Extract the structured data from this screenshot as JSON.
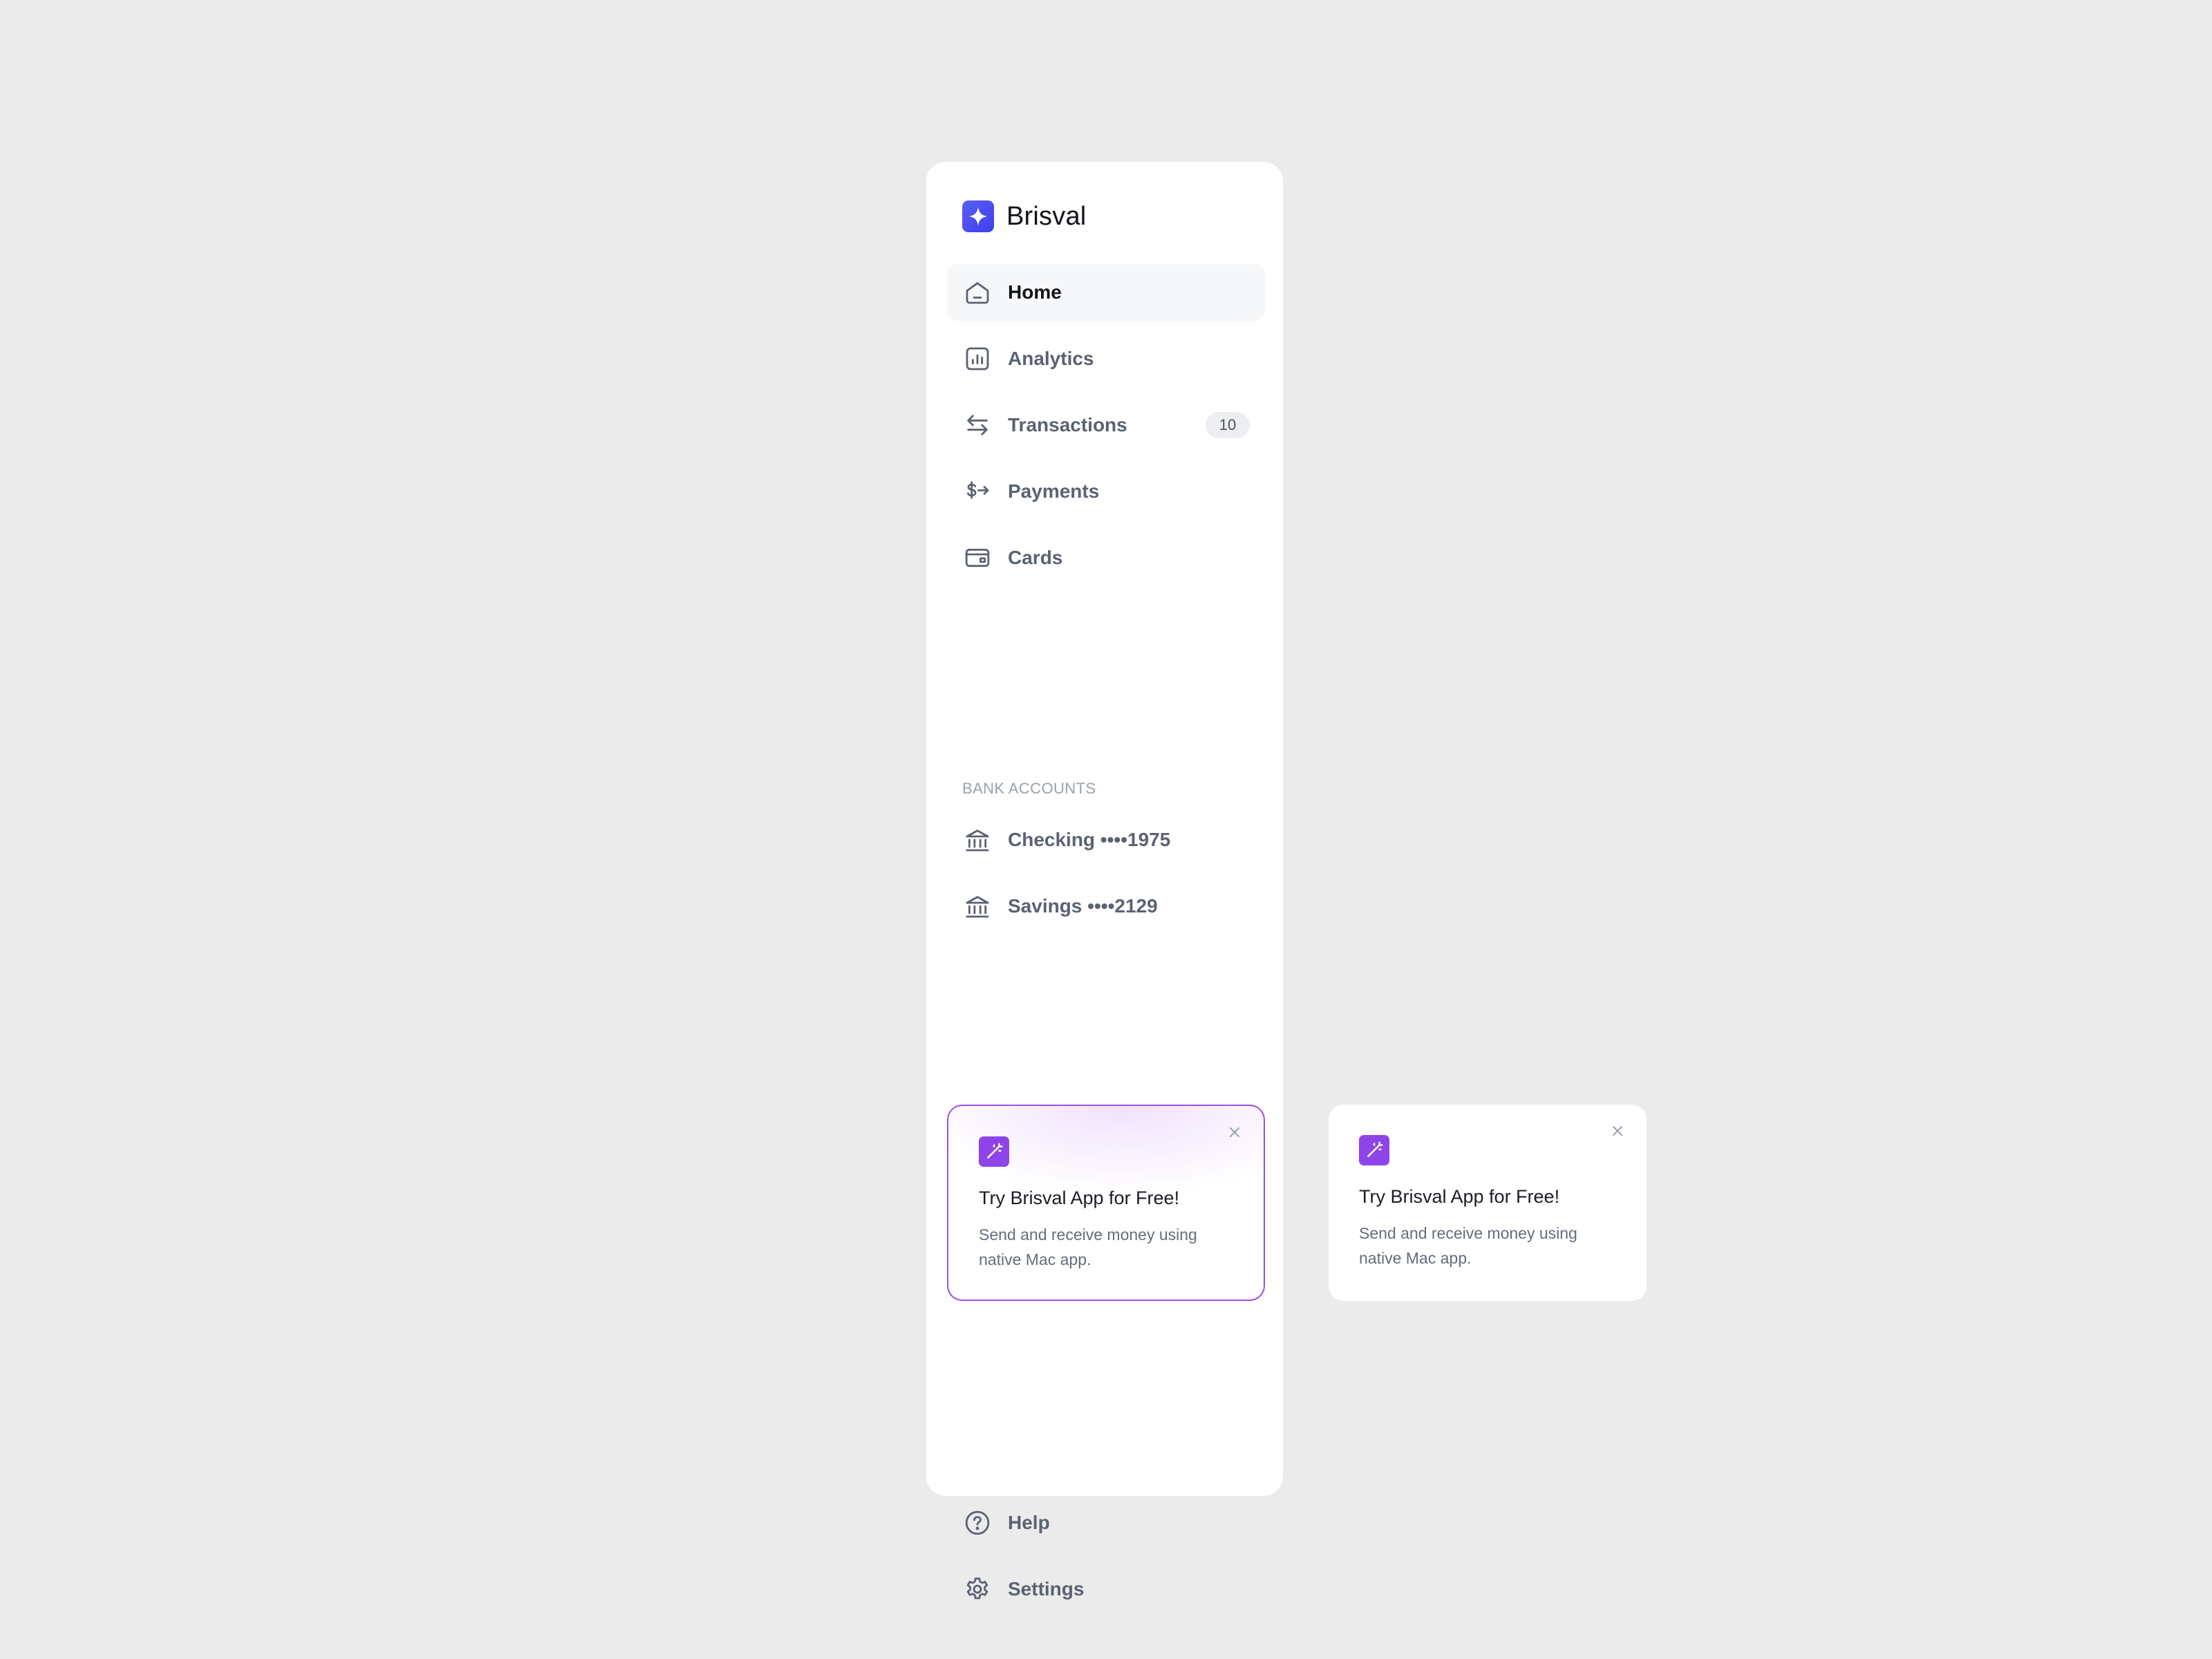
{
  "brand": {
    "name": "Brisval",
    "logo_icon": "sparkle-icon",
    "accent_color": "#4b4ef0"
  },
  "nav": {
    "items": [
      {
        "label": "Home",
        "icon": "home-icon",
        "active": true
      },
      {
        "label": "Analytics",
        "icon": "analytics-icon"
      },
      {
        "label": "Transactions",
        "icon": "transfer-arrows-icon",
        "badge": "10"
      },
      {
        "label": "Payments",
        "icon": "dollar-arrow-icon"
      },
      {
        "label": "Cards",
        "icon": "credit-card-icon"
      }
    ]
  },
  "bank_accounts": {
    "section_label": "BANK ACCOUNTS",
    "items": [
      {
        "label": "Checking ••••1975",
        "icon": "bank-icon"
      },
      {
        "label": "Savings ••••2129",
        "icon": "bank-icon"
      }
    ]
  },
  "promo": {
    "title": "Try Brisval App for Free!",
    "text": "Send and receive money using native Mac app.",
    "icon": "magic-wand-icon",
    "accent_color": "#8e44e8"
  },
  "footer_nav": {
    "items": [
      {
        "label": "Help",
        "icon": "help-circle-icon"
      },
      {
        "label": "Settings",
        "icon": "gear-icon"
      }
    ]
  }
}
